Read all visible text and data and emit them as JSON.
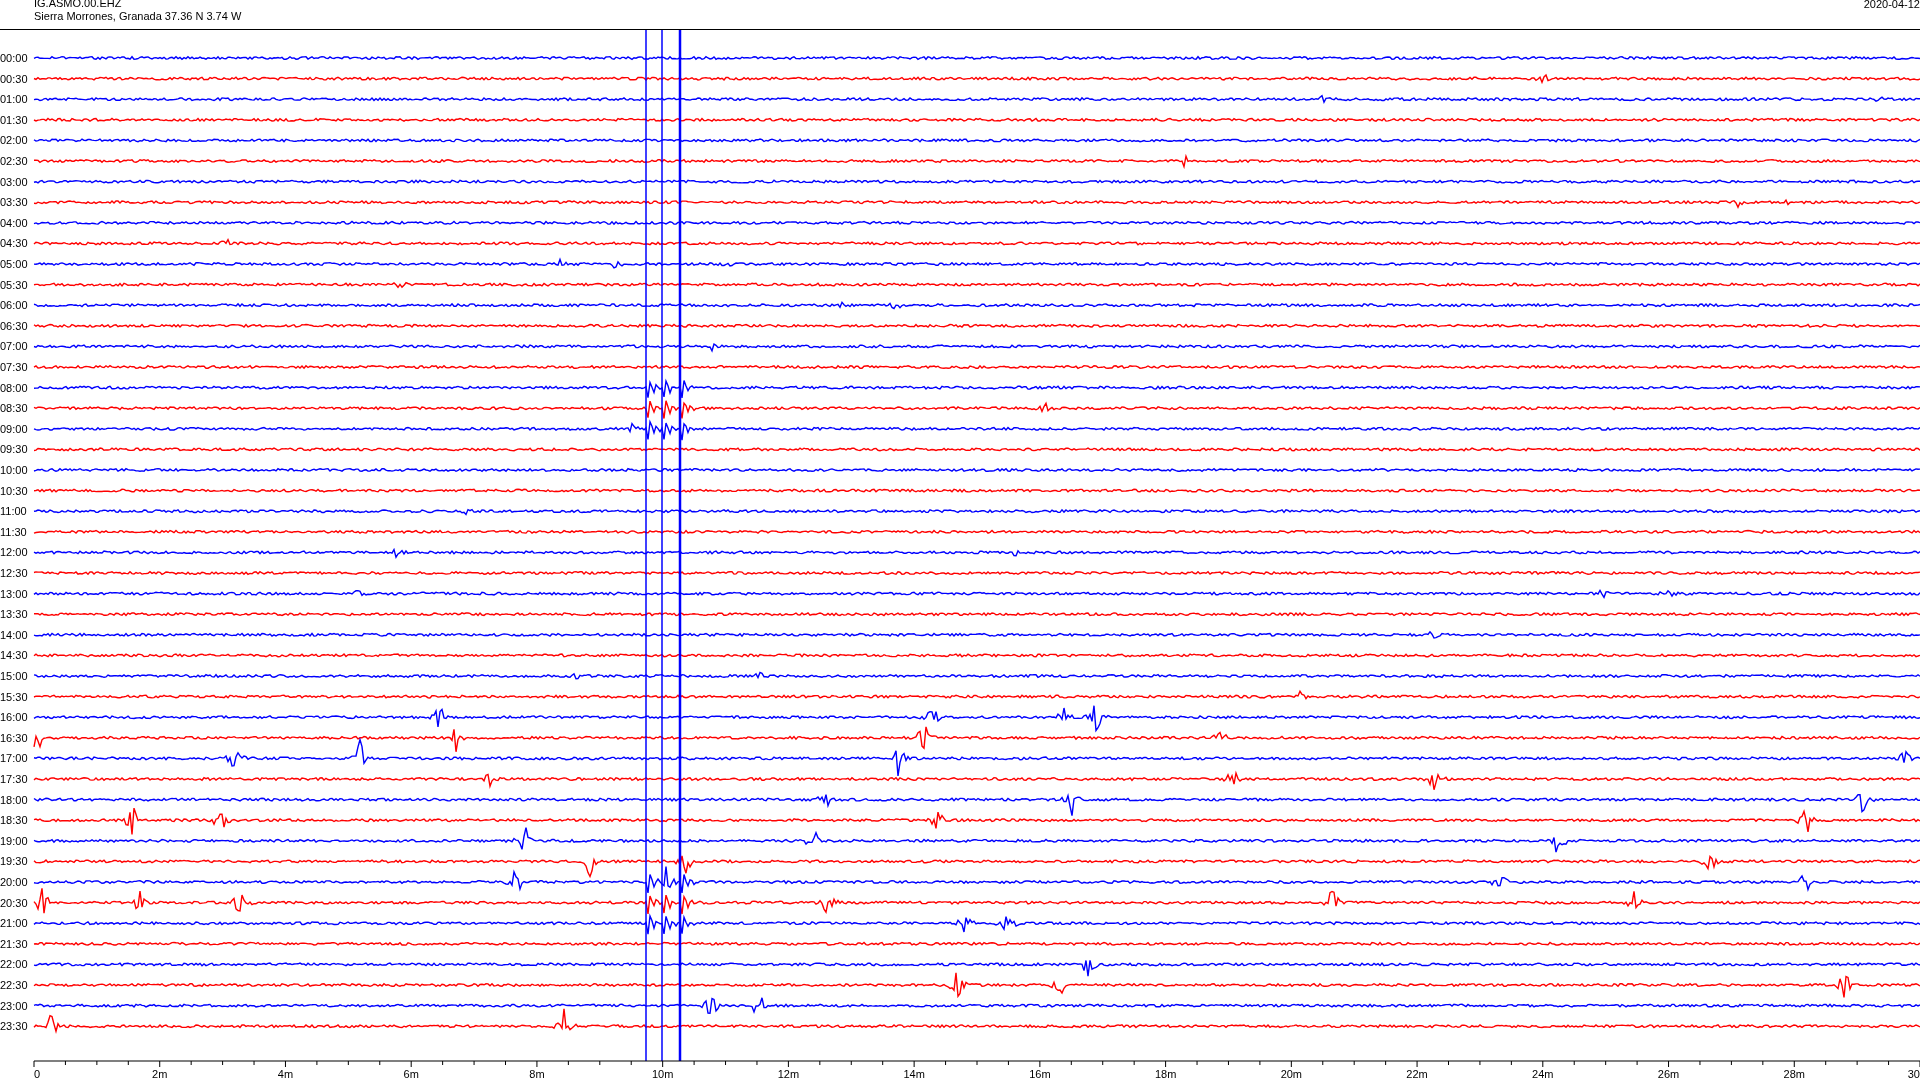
{
  "header": {
    "station": "IG.ASMO.00.EHZ",
    "location": "Sierra Morrones, Granada  37.36 N 3.74 W",
    "date": "2020-04-12"
  },
  "rows": [
    {
      "label": "00:00",
      "color": "#0000ff"
    },
    {
      "label": "00:30",
      "color": "#ff0000"
    },
    {
      "label": "01:00",
      "color": "#0000ff"
    },
    {
      "label": "01:30",
      "color": "#ff0000"
    },
    {
      "label": "02:00",
      "color": "#0000ff"
    },
    {
      "label": "02:30",
      "color": "#ff0000"
    },
    {
      "label": "03:00",
      "color": "#0000ff"
    },
    {
      "label": "03:30",
      "color": "#ff0000"
    },
    {
      "label": "04:00",
      "color": "#0000ff"
    },
    {
      "label": "04:30",
      "color": "#ff0000"
    },
    {
      "label": "05:00",
      "color": "#0000ff"
    },
    {
      "label": "05:30",
      "color": "#ff0000"
    },
    {
      "label": "06:00",
      "color": "#0000ff"
    },
    {
      "label": "06:30",
      "color": "#ff0000"
    },
    {
      "label": "07:00",
      "color": "#0000ff"
    },
    {
      "label": "07:30",
      "color": "#ff0000"
    },
    {
      "label": "08:00",
      "color": "#0000ff"
    },
    {
      "label": "08:30",
      "color": "#ff0000"
    },
    {
      "label": "09:00",
      "color": "#0000ff"
    },
    {
      "label": "09:30",
      "color": "#ff0000"
    },
    {
      "label": "10:00",
      "color": "#0000ff"
    },
    {
      "label": "10:30",
      "color": "#ff0000"
    },
    {
      "label": "11:00",
      "color": "#0000ff"
    },
    {
      "label": "11:30",
      "color": "#ff0000"
    },
    {
      "label": "12:00",
      "color": "#0000ff"
    },
    {
      "label": "12:30",
      "color": "#ff0000"
    },
    {
      "label": "13:00",
      "color": "#0000ff"
    },
    {
      "label": "13:30",
      "color": "#ff0000"
    },
    {
      "label": "14:00",
      "color": "#0000ff"
    },
    {
      "label": "14:30",
      "color": "#ff0000"
    },
    {
      "label": "15:00",
      "color": "#0000ff"
    },
    {
      "label": "15:30",
      "color": "#ff0000"
    },
    {
      "label": "16:00",
      "color": "#0000ff"
    },
    {
      "label": "16:30",
      "color": "#ff0000"
    },
    {
      "label": "17:00",
      "color": "#0000ff"
    },
    {
      "label": "17:30",
      "color": "#ff0000"
    },
    {
      "label": "18:00",
      "color": "#0000ff"
    },
    {
      "label": "18:30",
      "color": "#ff0000"
    },
    {
      "label": "19:00",
      "color": "#0000ff"
    },
    {
      "label": "19:30",
      "color": "#ff0000"
    },
    {
      "label": "20:00",
      "color": "#0000ff"
    },
    {
      "label": "20:30",
      "color": "#ff0000"
    },
    {
      "label": "21:00",
      "color": "#0000ff"
    },
    {
      "label": "21:30",
      "color": "#ff0000"
    },
    {
      "label": "22:00",
      "color": "#0000ff"
    },
    {
      "label": "22:30",
      "color": "#ff0000"
    },
    {
      "label": "23:00",
      "color": "#0000ff"
    },
    {
      "label": "23:30",
      "color": "#ff0000"
    }
  ],
  "axis": {
    "labels": [
      "0",
      "2m",
      "4m",
      "6m",
      "8m",
      "10m",
      "12m",
      "14m",
      "16m",
      "18m",
      "20m",
      "22m",
      "24m",
      "26m",
      "28m",
      "30"
    ]
  }
}
